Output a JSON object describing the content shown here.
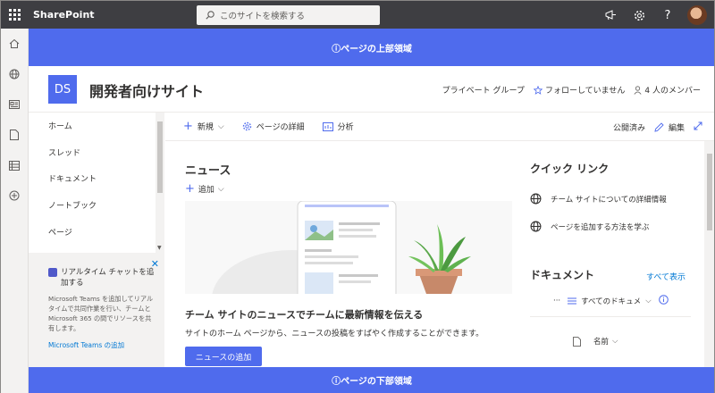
{
  "suite": {
    "brand": "SharePoint",
    "search_placeholder": "このサイトを検索する",
    "icons": [
      "waffle-icon",
      "megaphone-icon",
      "gear-icon",
      "help-icon",
      "avatar"
    ]
  },
  "regions": {
    "top": "ⓘページの上部領域",
    "bottom": "ⓘページの下部領域"
  },
  "site": {
    "logo": "DS",
    "title": "開発者向けサイト",
    "privacy": "プライベート グループ",
    "follow": "フォローしていません",
    "members": "4 人のメンバー"
  },
  "nav": {
    "items": [
      "ホーム",
      "スレッド",
      "ドキュメント",
      "ノートブック",
      "ページ"
    ]
  },
  "teams_card": {
    "title": "リアルタイム チャットを追加する",
    "description": "Microsoft Teams を追加してリアルタイムで共同作業を行い、チームと Microsoft 365 の間でリソースを共有します。",
    "link": "Microsoft Teams の追加"
  },
  "commandbar": {
    "new": "新規",
    "details": "ページの詳細",
    "analytics": "分析",
    "published": "公開済み",
    "edit": "編集"
  },
  "news": {
    "title": "ニュース",
    "add": "追加",
    "headline": "チーム サイトのニュースでチームに最新情報を伝える",
    "description": "サイトのホーム ページから、ニュースの投稿をすばやく作成することができます。",
    "button": "ニュースの追加"
  },
  "quick_links": {
    "title": "クイック リンク",
    "items": [
      "チーム サイトについての詳細情報",
      "ページを追加する方法を学ぶ"
    ]
  },
  "documents": {
    "title": "ドキュメント",
    "show_all": "すべて表示",
    "view": "すべてのドキュメ",
    "column_name": "名前"
  },
  "colors": {
    "accent": "#4f6bed",
    "suitebar": "#3e3e42",
    "link": "#0078d4"
  }
}
